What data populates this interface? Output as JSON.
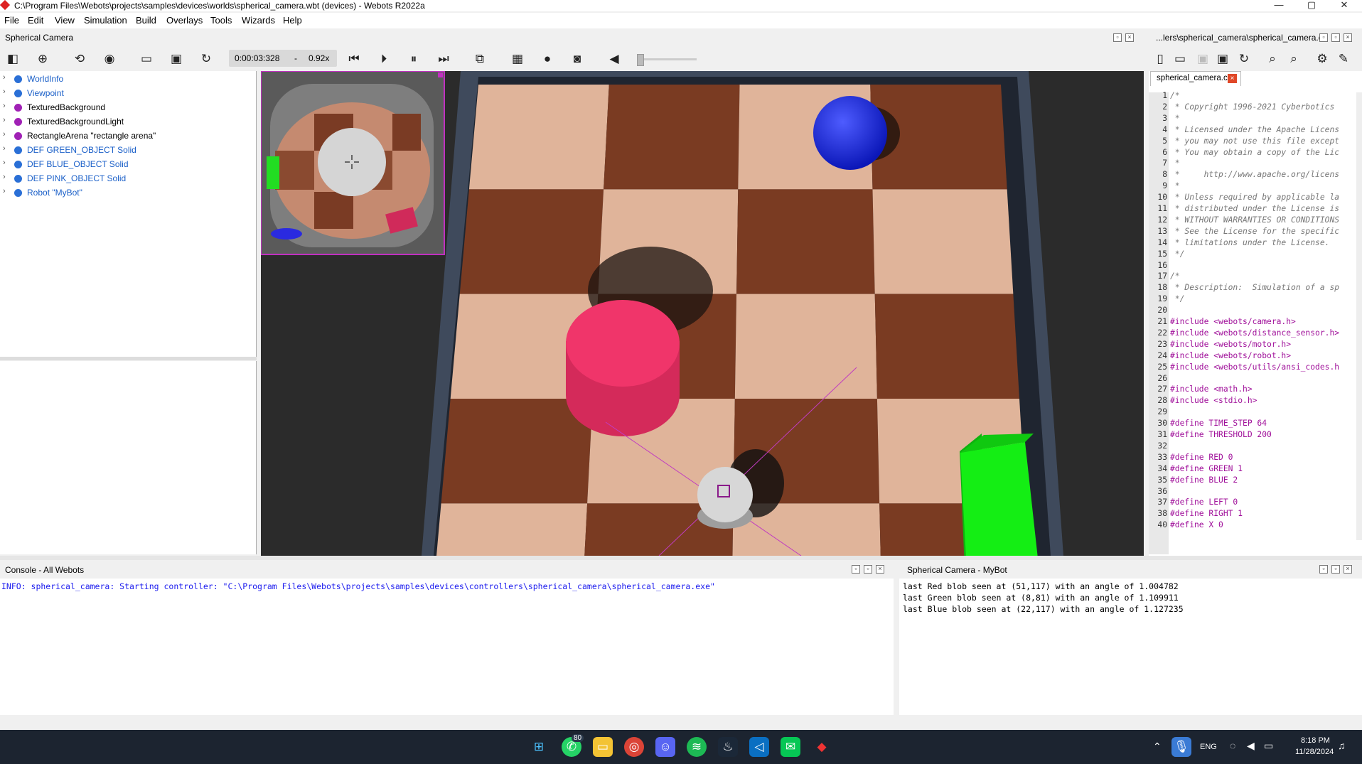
{
  "window": {
    "title": "C:\\Program Files\\Webots\\projects\\samples\\devices\\worlds\\spherical_camera.wbt (devices) - Webots R2022a",
    "minimize": "—",
    "maximize": "▢",
    "close": "✕"
  },
  "menu": [
    "File",
    "Edit",
    "View",
    "Simulation",
    "Build",
    "Overlays",
    "Tools",
    "Wizards",
    "Help"
  ],
  "left_pane": {
    "title": "Spherical Camera"
  },
  "toolbar": {
    "time": "0:00:03:328",
    "separator": "-",
    "speed": "0.92x"
  },
  "scene_tree": [
    {
      "label": "WorldInfo",
      "color": "#2a6fd6",
      "text_color": "#1a5fc8"
    },
    {
      "label": "Viewpoint",
      "color": "#2a6fd6",
      "text_color": "#1a5fc8"
    },
    {
      "label": "TexturedBackground",
      "color": "#a021b5",
      "text_color": "#000000"
    },
    {
      "label": "TexturedBackgroundLight",
      "color": "#a021b5",
      "text_color": "#000000"
    },
    {
      "label": "RectangleArena \"rectangle arena\"",
      "color": "#a021b5",
      "text_color": "#000000"
    },
    {
      "label": "DEF GREEN_OBJECT Solid",
      "color": "#2a6fd6",
      "text_color": "#1a5fc8"
    },
    {
      "label": "DEF BLUE_OBJECT Solid",
      "color": "#2a6fd6",
      "text_color": "#1a5fc8"
    },
    {
      "label": "DEF PINK_OBJECT Solid",
      "color": "#2a6fd6",
      "text_color": "#1a5fc8"
    },
    {
      "label": "Robot \"MyBot\"",
      "color": "#2a6fd6",
      "text_color": "#1a5fc8"
    }
  ],
  "editor": {
    "path": "...lers\\spherical_camera\\spherical_camera.c",
    "tab": "spherical_camera.c",
    "lines": [
      {
        "n": "1",
        "t": "/*",
        "c": "#777777"
      },
      {
        "n": "2",
        "t": " * Copyright 1996-2021 Cyberbotics",
        "c": "#777777"
      },
      {
        "n": "3",
        "t": " *",
        "c": "#777777"
      },
      {
        "n": "4",
        "t": " * Licensed under the Apache Licens",
        "c": "#777777"
      },
      {
        "n": "5",
        "t": " * you may not use this file except",
        "c": "#777777"
      },
      {
        "n": "6",
        "t": " * You may obtain a copy of the Lic",
        "c": "#777777"
      },
      {
        "n": "7",
        "t": " *",
        "c": "#777777"
      },
      {
        "n": "8",
        "t": " *     http://www.apache.org/licens",
        "c": "#777777"
      },
      {
        "n": "9",
        "t": " *",
        "c": "#777777"
      },
      {
        "n": "10",
        "t": " * Unless required by applicable la",
        "c": "#777777"
      },
      {
        "n": "11",
        "t": " * distributed under the License is",
        "c": "#777777"
      },
      {
        "n": "12",
        "t": " * WITHOUT WARRANTIES OR CONDITIONS",
        "c": "#777777"
      },
      {
        "n": "13",
        "t": " * See the License for the specific",
        "c": "#777777"
      },
      {
        "n": "14",
        "t": " * limitations under the License.",
        "c": "#777777"
      },
      {
        "n": "15",
        "t": " */",
        "c": "#777777"
      },
      {
        "n": "16",
        "t": "",
        "c": "#000000"
      },
      {
        "n": "17",
        "t": "/*",
        "c": "#777777"
      },
      {
        "n": "18",
        "t": " * Description:  Simulation of a sp",
        "c": "#777777"
      },
      {
        "n": "19",
        "t": " */",
        "c": "#777777"
      },
      {
        "n": "20",
        "t": "",
        "c": "#000000"
      },
      {
        "n": "21",
        "t": "#include <webots/camera.h>",
        "c": "#a0109a"
      },
      {
        "n": "22",
        "t": "#include <webots/distance_sensor.h>",
        "c": "#a0109a"
      },
      {
        "n": "23",
        "t": "#include <webots/motor.h>",
        "c": "#a0109a"
      },
      {
        "n": "24",
        "t": "#include <webots/robot.h>",
        "c": "#a0109a"
      },
      {
        "n": "25",
        "t": "#include <webots/utils/ansi_codes.h",
        "c": "#a0109a"
      },
      {
        "n": "26",
        "t": "",
        "c": "#000000"
      },
      {
        "n": "27",
        "t": "#include <math.h>",
        "c": "#a0109a"
      },
      {
        "n": "28",
        "t": "#include <stdio.h>",
        "c": "#a0109a"
      },
      {
        "n": "29",
        "t": "",
        "c": "#000000"
      },
      {
        "n": "30",
        "t": "#define TIME_STEP 64",
        "c": "#a0109a"
      },
      {
        "n": "31",
        "t": "#define THRESHOLD 200",
        "c": "#a0109a"
      },
      {
        "n": "32",
        "t": "",
        "c": "#000000"
      },
      {
        "n": "33",
        "t": "#define RED 0",
        "c": "#a0109a"
      },
      {
        "n": "34",
        "t": "#define GREEN 1",
        "c": "#a0109a"
      },
      {
        "n": "35",
        "t": "#define BLUE 2",
        "c": "#a0109a"
      },
      {
        "n": "36",
        "t": "",
        "c": "#000000"
      },
      {
        "n": "37",
        "t": "#define LEFT 0",
        "c": "#a0109a"
      },
      {
        "n": "38",
        "t": "#define RIGHT 1",
        "c": "#a0109a"
      },
      {
        "n": "40",
        "t": "#define X 0",
        "c": "#a0109a"
      }
    ]
  },
  "console_all": {
    "title": "Console - All Webots",
    "lines": [
      "INFO: spherical_camera: Starting controller: \"C:\\Program Files\\Webots\\projects\\samples\\devices\\controllers\\spherical_camera\\spherical_camera.exe\""
    ]
  },
  "console_robot": {
    "title": "Spherical Camera - MyBot",
    "lines": [
      "last Red blob seen at (51,117) with an angle of 1.004782",
      "last Green blob seen at (8,81) with an angle of 1.109911",
      "last Blue blob seen at (22,117) with an angle of 1.127235"
    ]
  },
  "taskbar": {
    "whatsapp_badge": "80",
    "lang": "ENG",
    "time": "8:18 PM",
    "date": "11/28/2024"
  },
  "colors": {
    "pink_object": "#f0356a",
    "blue_object": "#1a2de0",
    "green_object": "#14ee14",
    "light_wood": "#e0b49a",
    "dark_wood": "#7a3b22"
  }
}
